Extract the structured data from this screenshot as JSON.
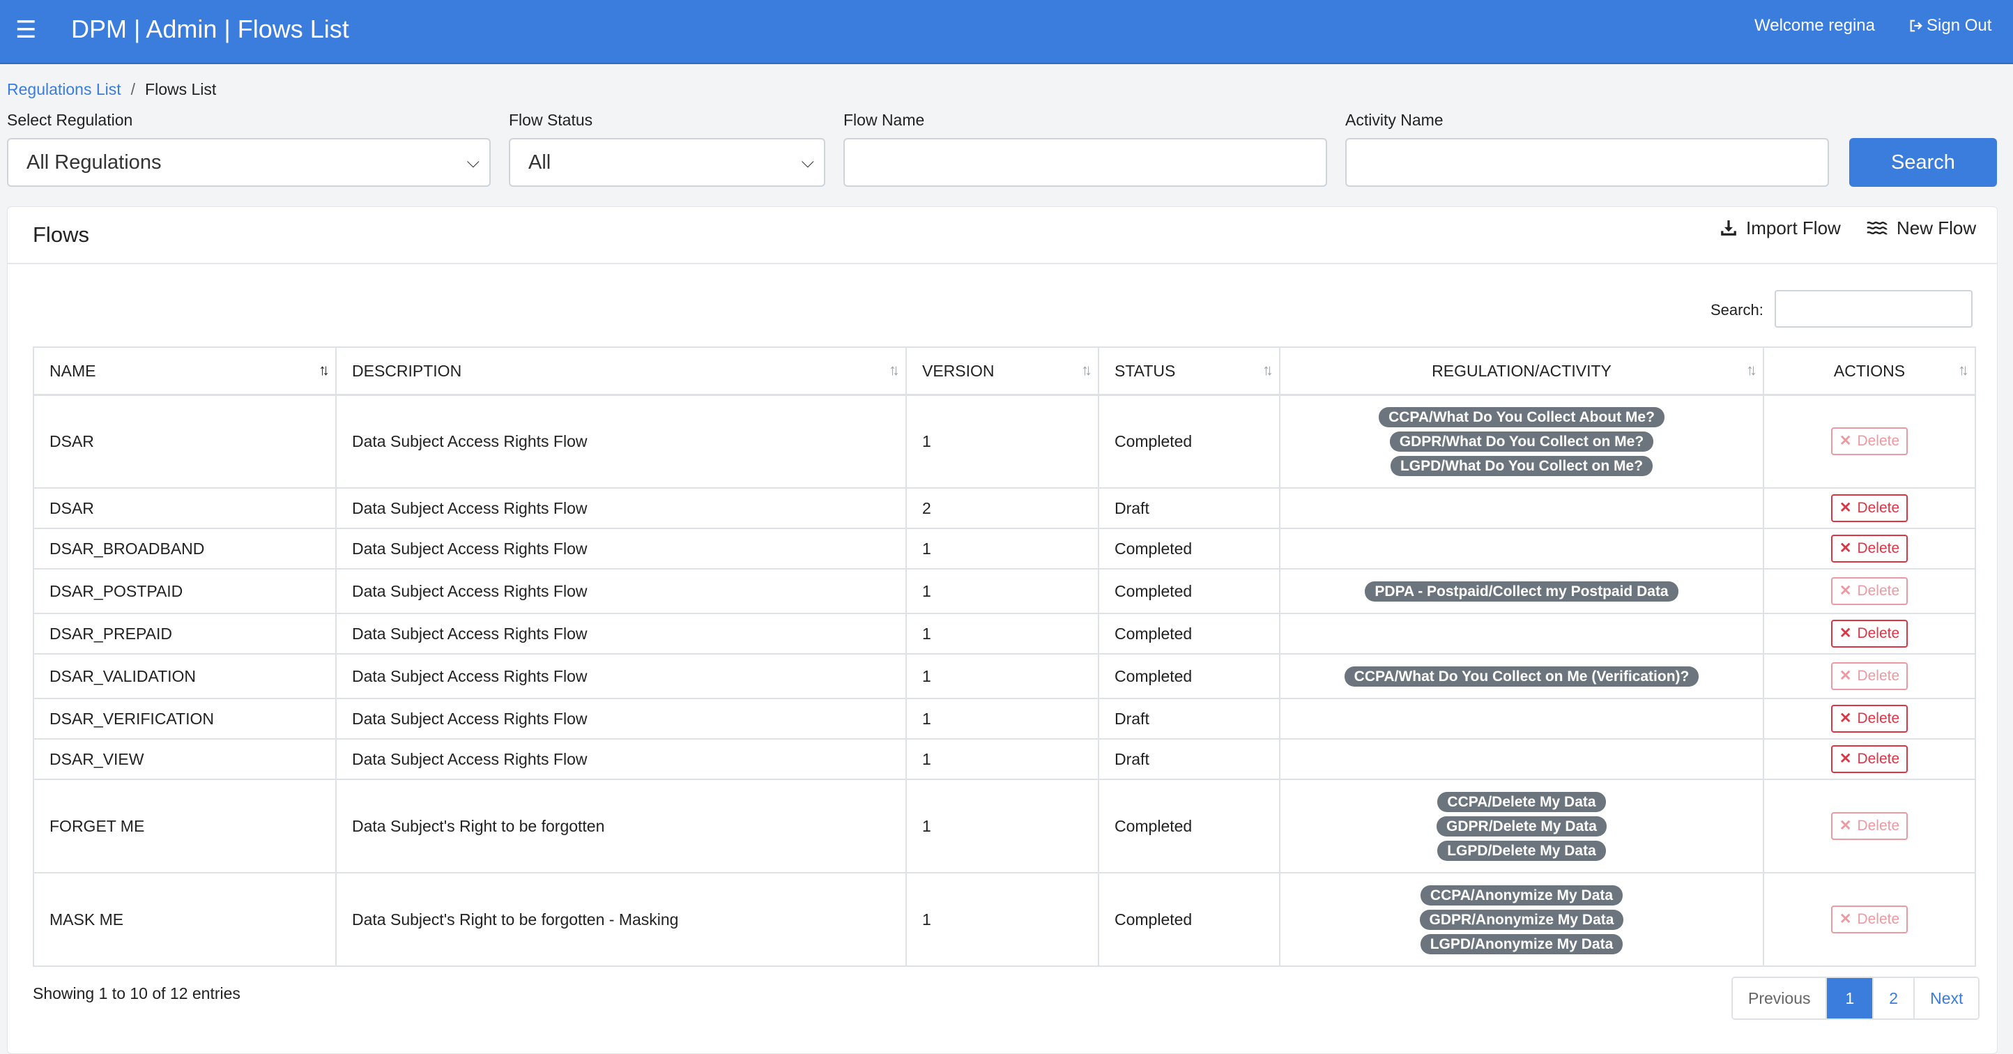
{
  "header": {
    "menu_icon": "hamburger-icon",
    "title": "DPM | Admin | Flows List",
    "welcome": "Welcome regina",
    "signout": "Sign Out",
    "accent": "#3b7ddd"
  },
  "breadcrumb": {
    "parent": "Regulations List",
    "current": "Flows List",
    "separator": "/"
  },
  "filters": {
    "regulation_label": "Select Regulation",
    "regulation_value": "All Regulations",
    "status_label": "Flow Status",
    "status_value": "All",
    "flow_name_label": "Flow Name",
    "flow_name_value": "",
    "activity_name_label": "Activity Name",
    "activity_name_value": "",
    "search_button": "Search"
  },
  "card": {
    "title": "Flows",
    "import_label": "Import Flow",
    "new_label": "New Flow",
    "search_label": "Search:",
    "search_value": ""
  },
  "table": {
    "columns": [
      "NAME",
      "DESCRIPTION",
      "VERSION",
      "STATUS",
      "REGULATION/ACTIVITY",
      "ACTIONS"
    ],
    "delete_label": "Delete",
    "rows": [
      {
        "name": "DSAR",
        "description": "Data Subject Access Rights Flow",
        "version": "1",
        "status": "Completed",
        "tags": [
          "CCPA/What Do You Collect About Me?",
          "GDPR/What Do You Collect on Me?",
          "LGPD/What Do You Collect on Me?"
        ],
        "delete_enabled": false
      },
      {
        "name": "DSAR",
        "description": "Data Subject Access Rights Flow",
        "version": "2",
        "status": "Draft",
        "tags": [],
        "delete_enabled": true
      },
      {
        "name": "DSAR_BROADBAND",
        "description": "Data Subject Access Rights Flow",
        "version": "1",
        "status": "Completed",
        "tags": [],
        "delete_enabled": true
      },
      {
        "name": "DSAR_POSTPAID",
        "description": "Data Subject Access Rights Flow",
        "version": "1",
        "status": "Completed",
        "tags": [
          "PDPA - Postpaid/Collect my Postpaid Data"
        ],
        "delete_enabled": false
      },
      {
        "name": "DSAR_PREPAID",
        "description": "Data Subject Access Rights Flow",
        "version": "1",
        "status": "Completed",
        "tags": [],
        "delete_enabled": true
      },
      {
        "name": "DSAR_VALIDATION",
        "description": "Data Subject Access Rights Flow",
        "version": "1",
        "status": "Completed",
        "tags": [
          "CCPA/What Do You Collect on Me (Verification)?"
        ],
        "delete_enabled": false
      },
      {
        "name": "DSAR_VERIFICATION",
        "description": "Data Subject Access Rights Flow",
        "version": "1",
        "status": "Draft",
        "tags": [],
        "delete_enabled": true
      },
      {
        "name": "DSAR_VIEW",
        "description": "Data Subject Access Rights Flow",
        "version": "1",
        "status": "Draft",
        "tags": [],
        "delete_enabled": true
      },
      {
        "name": "FORGET ME",
        "description": "Data Subject's Right to be forgotten",
        "version": "1",
        "status": "Completed",
        "tags": [
          "CCPA/Delete My Data",
          "GDPR/Delete My Data",
          "LGPD/Delete My Data"
        ],
        "delete_enabled": false
      },
      {
        "name": "MASK ME",
        "description": "Data Subject's Right to be forgotten - Masking",
        "version": "1",
        "status": "Completed",
        "tags": [
          "CCPA/Anonymize My Data",
          "GDPR/Anonymize My Data",
          "LGPD/Anonymize My Data"
        ],
        "delete_enabled": false
      }
    ]
  },
  "footer": {
    "info": "Showing 1 to 10 of 12 entries",
    "pages": [
      "Previous",
      "1",
      "2",
      "Next"
    ],
    "active_page": "1"
  }
}
